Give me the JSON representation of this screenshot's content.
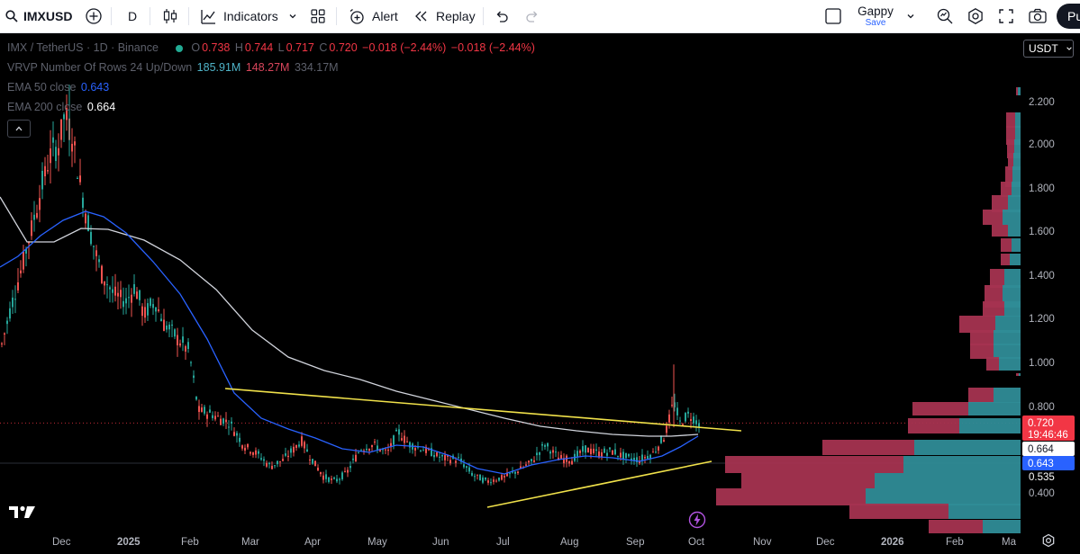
{
  "toolbar": {
    "symbol": "IMXUSD",
    "interval": "D",
    "indicators_label": "Indicators",
    "alert_label": "Alert",
    "replay_label": "Replay",
    "layout_name": "Gappy",
    "layout_save": "Save",
    "publish_label": "Pu"
  },
  "legend": {
    "pair": "IMX / TetherUS · 1D · Binance",
    "o_label": "O",
    "o": "0.738",
    "h_label": "H",
    "h": "0.744",
    "l_label": "L",
    "l": "0.717",
    "c_label": "C",
    "c": "0.720",
    "change": "−0.018 (−2.44%)",
    "change2": "−0.018 (−2.44%)",
    "vrvp_label": "VRVP Number Of Rows 24 Up/Down",
    "vrvp_up": "185.91M",
    "vrvp_down": "148.27M",
    "vrvp_total": "334.17M",
    "ema50_label": "EMA 50 close",
    "ema50_value": "0.643",
    "ema200_label": "EMA 200 close",
    "ema200_value": "0.664"
  },
  "currency": "USDT",
  "price_axis": [
    "2.200",
    "2.000",
    "1.800",
    "1.600",
    "1.400",
    "1.200",
    "1.000",
    "0.800",
    "0.400"
  ],
  "price_tags": {
    "last_price": "0.720",
    "countdown": "19:46:46",
    "ema200": "0.664",
    "ema50": "0.643",
    "level": "0.535"
  },
  "time_axis": [
    "Dec",
    "2025",
    "Feb",
    "Mar",
    "Apr",
    "May",
    "Jun",
    "Jul",
    "Aug",
    "Sep",
    "Oct",
    "Nov",
    "Dec",
    "2026",
    "Feb",
    "Ma"
  ],
  "colors": {
    "up": "#26a69a",
    "down": "#ef5350",
    "ema50": "#2962ff",
    "ema200": "#d1d4dc",
    "trendline": "#f0e14a",
    "vp_up": "#2f8c97",
    "vp_down": "#a53350"
  },
  "chart_data": {
    "type": "candlestick",
    "symbol": "IMX / TetherUS",
    "timeframe": "1D",
    "exchange": "Binance",
    "last": {
      "open": 0.738,
      "high": 0.744,
      "low": 0.717,
      "close": 0.72
    },
    "ema50": 0.643,
    "ema200": 0.664,
    "price_range": [
      0.35,
      2.3
    ]
  }
}
